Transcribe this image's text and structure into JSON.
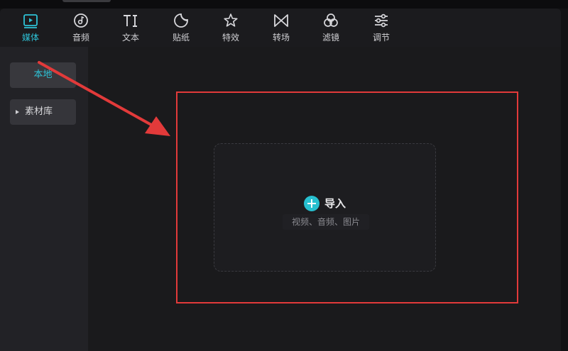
{
  "toolbar": {
    "tabs": [
      {
        "label": "媒体",
        "icon": "media-play-icon",
        "active": true
      },
      {
        "label": "音频",
        "icon": "audio-disc-icon",
        "active": false
      },
      {
        "label": "文本",
        "icon": "text-ti-icon",
        "active": false
      },
      {
        "label": "贴纸",
        "icon": "sticker-icon",
        "active": false
      },
      {
        "label": "特效",
        "icon": "effects-star-icon",
        "active": false
      },
      {
        "label": "转场",
        "icon": "transition-bowtie-icon",
        "active": false
      },
      {
        "label": "滤镜",
        "icon": "filter-circles-icon",
        "active": false
      },
      {
        "label": "调节",
        "icon": "adjust-sliders-icon",
        "active": false
      }
    ]
  },
  "sidebar": {
    "local_label": "本地",
    "library_label": "素材库"
  },
  "main": {
    "import_label": "导入",
    "import_hint": "视频、音频、图片"
  },
  "colors": {
    "accent": "#2ec2d6",
    "annotation": "#e23a3a",
    "background": "#1a1a1c"
  }
}
